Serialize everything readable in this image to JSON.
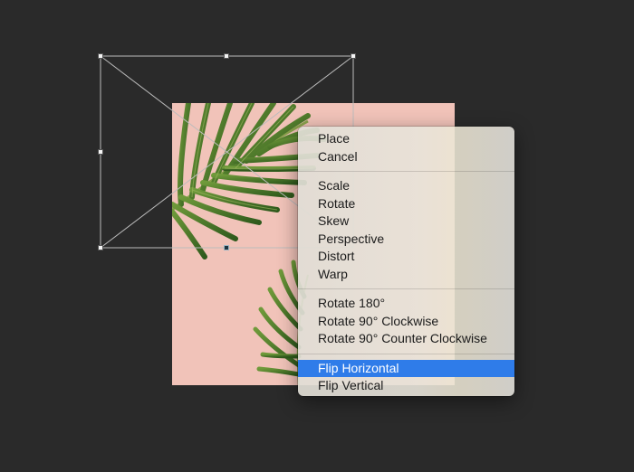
{
  "menu": {
    "groups": [
      {
        "items": [
          {
            "label": "Place",
            "selected": false
          },
          {
            "label": "Cancel",
            "selected": false
          }
        ]
      },
      {
        "items": [
          {
            "label": "Scale",
            "selected": false
          },
          {
            "label": "Rotate",
            "selected": false
          },
          {
            "label": "Skew",
            "selected": false
          },
          {
            "label": "Perspective",
            "selected": false
          },
          {
            "label": "Distort",
            "selected": false
          },
          {
            "label": "Warp",
            "selected": false
          }
        ]
      },
      {
        "items": [
          {
            "label": "Rotate 180°",
            "selected": false
          },
          {
            "label": "Rotate 90° Clockwise",
            "selected": false
          },
          {
            "label": "Rotate 90° Counter Clockwise",
            "selected": false
          }
        ]
      },
      {
        "items": [
          {
            "label": "Flip Horizontal",
            "selected": true
          },
          {
            "label": "Flip Vertical",
            "selected": false
          }
        ]
      }
    ],
    "selected_color": "#2f7ce9"
  },
  "canvas": {
    "background_color": "#2a2a2a",
    "photo_background_color": "#f1c3b9",
    "photo_subject": "palm-leaf-image"
  }
}
